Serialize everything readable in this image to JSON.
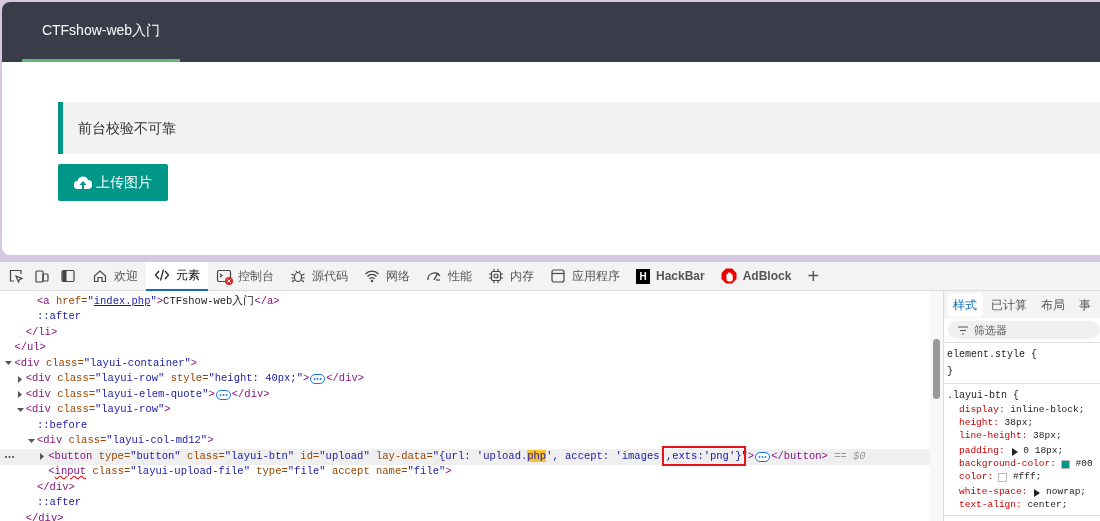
{
  "page": {
    "nav": [
      {
        "label": "CTFshow-web入门",
        "selected": true
      }
    ],
    "quote": "前台校验不可靠",
    "upload_button": "上传图片"
  },
  "devtools": {
    "tabs": [
      {
        "label": "欢迎",
        "kind": "home",
        "selected": false
      },
      {
        "label": "元素",
        "kind": "code",
        "selected": true
      },
      {
        "label": "控制台",
        "kind": "console",
        "selected": false,
        "error_badge": true
      },
      {
        "label": "源代码",
        "kind": "bug",
        "selected": false
      },
      {
        "label": "网络",
        "kind": "wifi",
        "selected": false
      },
      {
        "label": "性能",
        "kind": "gauge",
        "selected": false
      },
      {
        "label": "内存",
        "kind": "chip",
        "selected": false
      },
      {
        "label": "应用程序",
        "kind": "window",
        "selected": false
      },
      {
        "label": "HackBar",
        "kind": "letter",
        "letter": "H",
        "selected": false
      },
      {
        "label": "AdBlock",
        "kind": "stop",
        "selected": false
      }
    ],
    "add_tab": "+",
    "dom": [
      {
        "selected": false,
        "children": [
          {
            "selected": false,
            "children": [
              {
                "selected": false,
                "parts": [
                  {
                    "kind": "tag",
                    "text": "<a"
                  },
                  {
                    "kind": "attr",
                    "text": " href="
                  },
                  {
                    "kind": "value",
                    "text": "\""
                  },
                  {
                    "kind": "link",
                    "text": "index.php"
                  },
                  {
                    "kind": "value",
                    "text": "\""
                  },
                  {
                    "kind": "tag",
                    "text": ">"
                  },
                  {
                    "kind": "plain",
                    "text": "CTFshow-web入门"
                  },
                  {
                    "kind": "tag",
                    "text": "</a>"
                  }
                ]
              },
              {
                "selected": false,
                "parts": [
                  {
                    "kind": "pseudo",
                    "text": "::after"
                  }
                ]
              }
            ],
            "close": [
              {
                "kind": "tag",
                "text": "</li>"
              }
            ]
          }
        ],
        "close": [
          {
            "kind": "tag",
            "text": "</ul>"
          }
        ]
      },
      {
        "selected": false,
        "expanded": true,
        "parts": [
          {
            "kind": "tag",
            "text": "<div"
          },
          {
            "kind": "attr",
            "text": " class="
          },
          {
            "kind": "value",
            "text": "\"layui-container\""
          },
          {
            "kind": "tag",
            "text": ">"
          }
        ],
        "children": [
          {
            "selected": false,
            "expanded": false,
            "parts": [
              {
                "kind": "tag",
                "text": "<div"
              },
              {
                "kind": "attr",
                "text": " class="
              },
              {
                "kind": "value",
                "text": "\"layui-row\""
              },
              {
                "kind": "attr",
                "text": " style="
              },
              {
                "kind": "value",
                "text": "\"height: 40px;\""
              },
              {
                "kind": "tag",
                "text": ">"
              },
              {
                "kind": "more"
              },
              {
                "kind": "tag",
                "text": "</div>"
              }
            ]
          },
          {
            "selected": false,
            "expanded": false,
            "parts": [
              {
                "kind": "tag",
                "text": "<div"
              },
              {
                "kind": "attr",
                "text": " class="
              },
              {
                "kind": "value",
                "text": "\"layui-elem-quote\""
              },
              {
                "kind": "tag",
                "text": ">"
              },
              {
                "kind": "more"
              },
              {
                "kind": "tag",
                "text": "</div>"
              }
            ]
          },
          {
            "selected": false,
            "expanded": true,
            "parts": [
              {
                "kind": "tag",
                "text": "<div"
              },
              {
                "kind": "attr",
                "text": " class="
              },
              {
                "kind": "value",
                "text": "\"layui-row\""
              },
              {
                "kind": "tag",
                "text": ">"
              }
            ],
            "children": [
              {
                "selected": false,
                "parts": [
                  {
                    "kind": "pseudo",
                    "text": "::before"
                  }
                ]
              },
              {
                "selected": false,
                "expanded": true,
                "parts": [
                  {
                    "kind": "tag",
                    "text": "<div"
                  },
                  {
                    "kind": "attr",
                    "text": " class="
                  },
                  {
                    "kind": "value",
                    "text": "\"layui-col-md12\""
                  },
                  {
                    "kind": "tag",
                    "text": ">"
                  }
                ],
                "children": [
                  {
                    "selected": true,
                    "expanded": false,
                    "parts": [
                      {
                        "kind": "tag",
                        "text": "<button"
                      },
                      {
                        "kind": "attr",
                        "text": " type="
                      },
                      {
                        "kind": "value",
                        "text": "\"button\""
                      },
                      {
                        "kind": "attr",
                        "text": " class="
                      },
                      {
                        "kind": "value",
                        "text": "\"layui-btn\""
                      },
                      {
                        "kind": "attr",
                        "text": " id="
                      },
                      {
                        "kind": "value",
                        "text": "\"upload\""
                      },
                      {
                        "kind": "attr",
                        "text": " lay-data="
                      },
                      {
                        "kind": "value",
                        "text": "\"{url: 'upload."
                      },
                      {
                        "kind": "hl",
                        "text": "php"
                      },
                      {
                        "kind": "value",
                        "text": "', accept: 'images "
                      },
                      {
                        "kind": "marked",
                        "text": ",exts:'png'}"
                      },
                      {
                        "kind": "value",
                        "text": "\""
                      },
                      {
                        "kind": "tag",
                        "text": ">"
                      },
                      {
                        "kind": "more"
                      },
                      {
                        "kind": "tag",
                        "text": "</button>"
                      },
                      {
                        "kind": "note",
                        "text": " == $0"
                      }
                    ]
                  },
                  {
                    "selected": false,
                    "parts": [
                      {
                        "kind": "tag",
                        "text": "<"
                      },
                      {
                        "kind": "squiggle",
                        "text": "input"
                      },
                      {
                        "kind": "attr",
                        "text": " class="
                      },
                      {
                        "kind": "value",
                        "text": "\"layui-upload-file\""
                      },
                      {
                        "kind": "attr",
                        "text": " type="
                      },
                      {
                        "kind": "value",
                        "text": "\"file\""
                      },
                      {
                        "kind": "attr",
                        "text": " accept name="
                      },
                      {
                        "kind": "value",
                        "text": "\"file\""
                      },
                      {
                        "kind": "tag",
                        "text": ">"
                      }
                    ]
                  }
                ],
                "close": [
                  {
                    "kind": "tag",
                    "text": "</div>"
                  }
                ]
              },
              {
                "selected": false,
                "parts": [
                  {
                    "kind": "pseudo",
                    "text": "::after"
                  }
                ]
              }
            ],
            "close": [
              {
                "kind": "tag",
                "text": "</div>"
              }
            ]
          }
        ]
      }
    ],
    "styles": {
      "tabs": [
        {
          "label": "样式",
          "selected": true
        },
        {
          "label": "已计算",
          "selected": false
        },
        {
          "label": "布局",
          "selected": false
        },
        {
          "label": "事",
          "selected": false
        }
      ],
      "filter": {
        "placeholder": "筛选器"
      },
      "rules": [
        {
          "selector": "element.style",
          "open": " {",
          "close": "}"
        },
        {
          "selector": ".layui-btn",
          "open": " {",
          "props": [
            {
              "name": "display:",
              "value": " inline-block;"
            },
            {
              "name": "height:",
              "value": " 38px;"
            },
            {
              "name": "line-height:",
              "value": " 38px;"
            },
            {
              "name": "padding:",
              "value": " 0 18px;",
              "expandable": true
            },
            {
              "name": "background-color:",
              "value": " #00",
              "color": "#009688"
            },
            {
              "name": "color:",
              "value": " #fff;",
              "color": "#ffffff"
            },
            {
              "name": "white-space:",
              "value": " nowrap;",
              "expandable": true
            },
            {
              "name": "text-align:",
              "value": " center;"
            }
          ]
        }
      ]
    }
  }
}
